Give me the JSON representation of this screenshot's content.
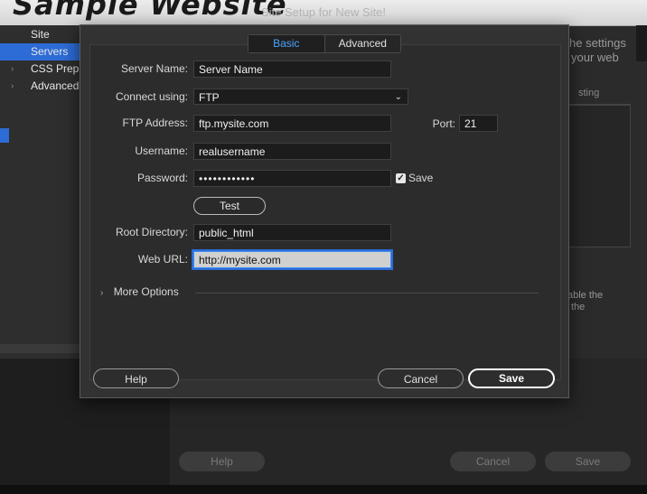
{
  "background": {
    "partial_heading": "Sample Website",
    "window_title": "Site Setup for New Site!",
    "sidebar_items": [
      {
        "label": "Site",
        "expandable": false
      },
      {
        "label": "Servers",
        "expandable": false,
        "selected": true
      },
      {
        "label": "CSS Preprocessors",
        "expandable": true
      },
      {
        "label": "Advanced Settings",
        "expandable": true
      }
    ],
    "right_text_1": "he settings",
    "right_text_2": "your web",
    "panel_header": "sting",
    "right_text_3": "able the",
    "right_text_4": "the",
    "help_label": "Help",
    "cancel_label": "Cancel",
    "save_label": "Save"
  },
  "dialog": {
    "tabs": [
      {
        "label": "Basic",
        "active": true
      },
      {
        "label": "Advanced",
        "active": false
      }
    ],
    "fields": {
      "server_name": {
        "label": "Server Name:",
        "value": "Server Name"
      },
      "connect_using": {
        "label": "Connect using:",
        "value": "FTP"
      },
      "ftp_address": {
        "label": "FTP Address:",
        "value": "ftp.mysite.com"
      },
      "port": {
        "label": "Port:",
        "value": "21"
      },
      "username": {
        "label": "Username:",
        "value": "realusername"
      },
      "password": {
        "label": "Password:",
        "value": "••••••••••••"
      },
      "save_password": {
        "label": "Save",
        "checked": true
      },
      "root_directory": {
        "label": "Root Directory:",
        "value": "public_html"
      },
      "web_url": {
        "label": "Web URL:",
        "value": "http://mysite.com"
      }
    },
    "test_label": "Test",
    "more_options_label": "More Options",
    "help_label": "Help",
    "cancel_label": "Cancel",
    "save_label": "Save"
  },
  "icons": {
    "select_arrow": "chevron-down-icon",
    "more_options": "chevron-right-icon",
    "checkbox": "checkmark-icon"
  },
  "colors": {
    "accent": "#4aa3ff",
    "selection": "#2d6bd6"
  }
}
